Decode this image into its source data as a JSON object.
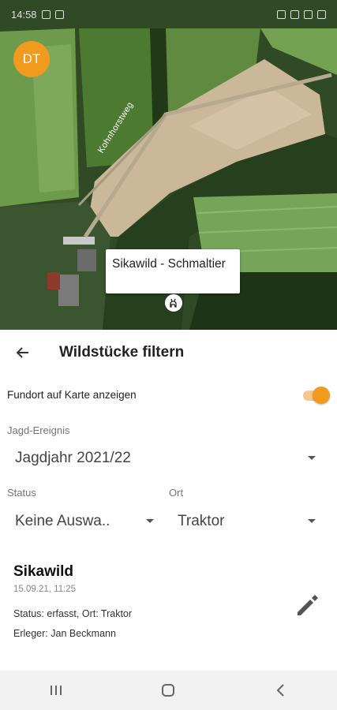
{
  "status_bar": {
    "time": "14:58"
  },
  "map": {
    "avatar_initials": "DT",
    "road_label": "Kohnhorstweg",
    "callout_text": "Sikawild - Schmaltier",
    "marker_icon": "deer-icon"
  },
  "header": {
    "title": "Wildstücke filtern",
    "back_icon": "arrow-left-icon"
  },
  "toggle": {
    "label": "Fundort auf Karte anzeigen",
    "on": true,
    "color": "#f19a1e"
  },
  "filters": {
    "event_label": "Jagd-Ereignis",
    "event_value": "Jagdjahr 2021/22",
    "status_label": "Status",
    "status_value": "Keine Auswa..",
    "location_label": "Ort",
    "location_value": "Traktor"
  },
  "card": {
    "title": "Sikawild",
    "date": "15.09.21, 11:25",
    "status_line": "Status: erfasst, Ort: Traktor",
    "hunter_line": "Erleger: Jan Beckmann",
    "edit_icon": "pencil-icon"
  },
  "nav": {
    "recents_icon": "recents-icon",
    "home_icon": "home-icon",
    "back_icon": "back-icon"
  },
  "colors": {
    "accent": "#f19a1e"
  }
}
